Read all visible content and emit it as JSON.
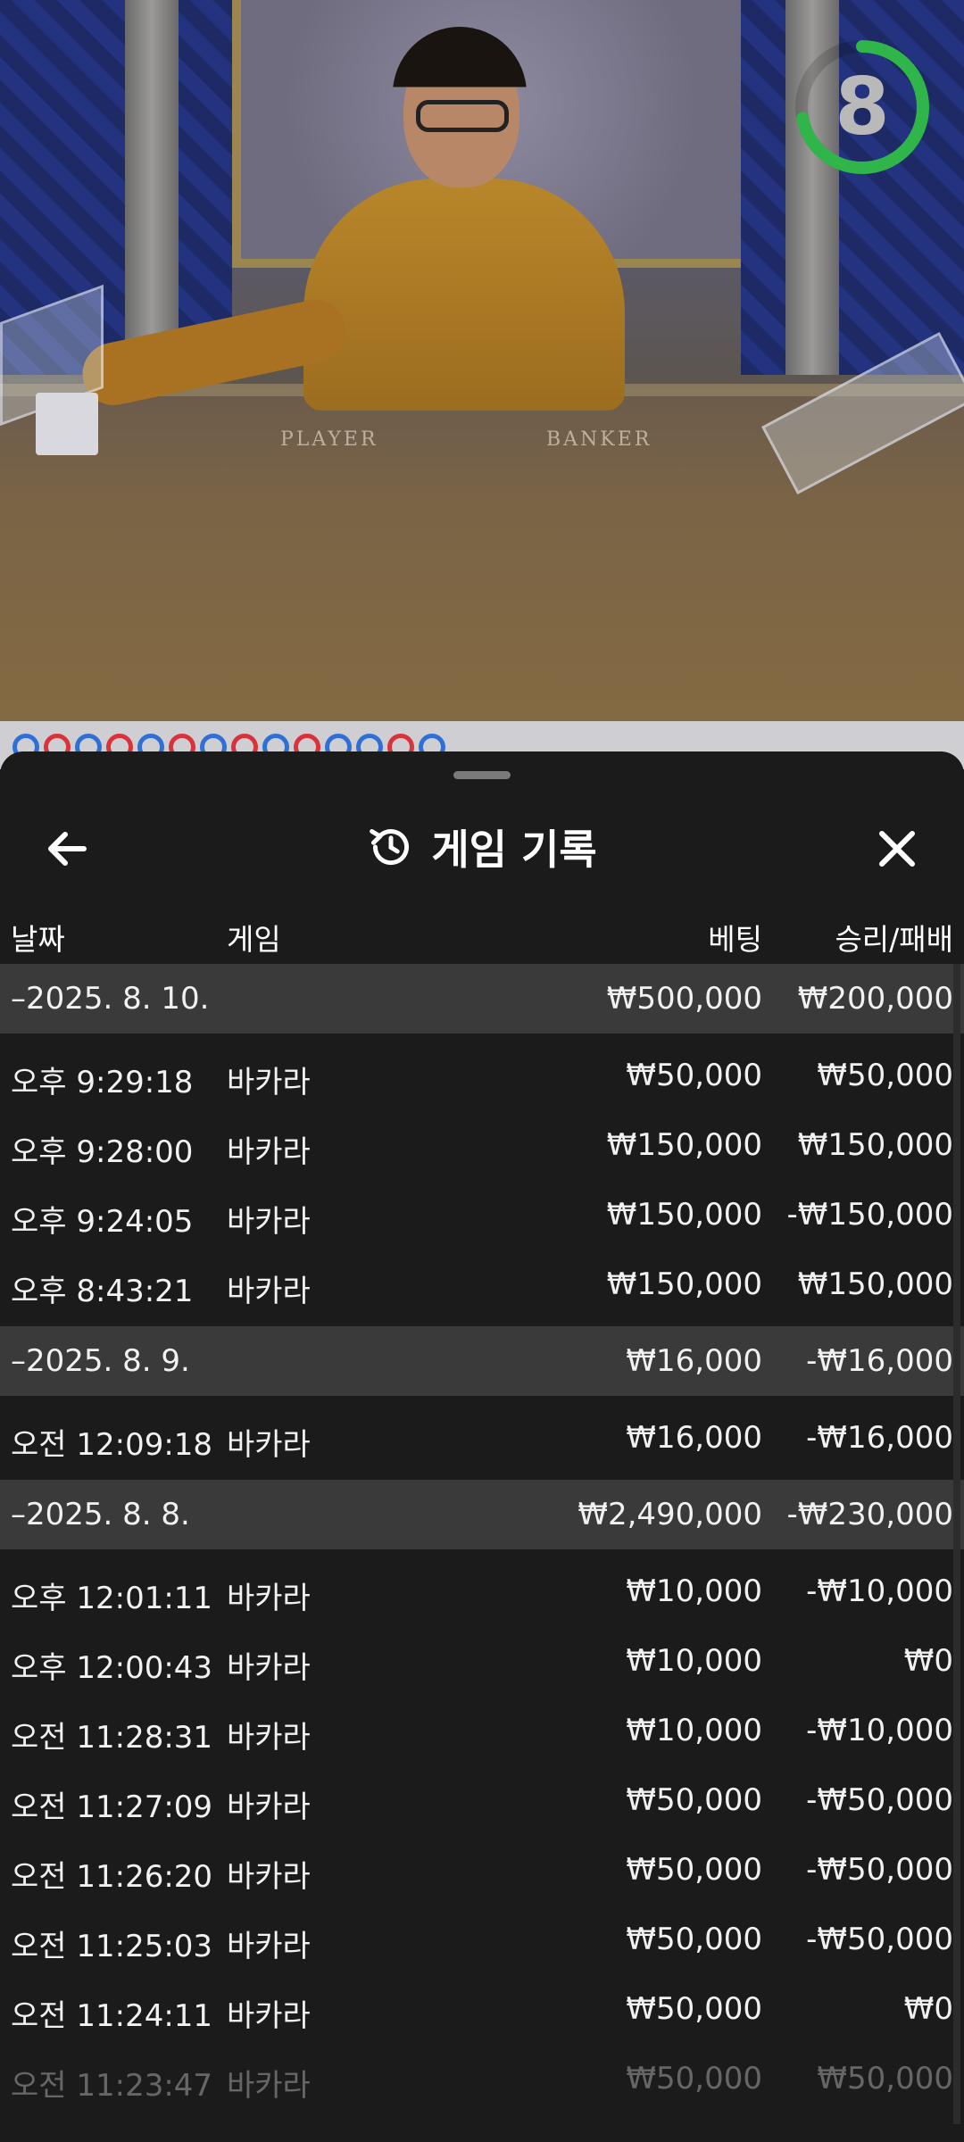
{
  "timer": {
    "value": "8",
    "fraction_remaining": 0.72,
    "color": "#2fb54a"
  },
  "table_felt": {
    "player": "PLAYER",
    "banker": "BANKER"
  },
  "roadmap": {
    "results": [
      "blue",
      "red",
      "blue",
      "red",
      "blue",
      "red",
      "blue",
      "red",
      "blue",
      "red",
      "blue",
      "blue",
      "red",
      "blue"
    ]
  },
  "sheet": {
    "title": "게임 기록",
    "back_icon": "arrow-left-icon",
    "history_icon": "history-icon",
    "close_icon": "close-icon"
  },
  "columns": {
    "date": "날짜",
    "game": "게임",
    "bet": "베팅",
    "win_loss": "승리/패배"
  },
  "rows": [
    {
      "type": "group",
      "date": "–2025. 8. 10.",
      "game": "",
      "bet": "₩500,000",
      "win_loss": "₩200,000"
    },
    {
      "type": "item",
      "date": "오후 9:29:18",
      "game": "바카라",
      "bet": "₩50,000",
      "win_loss": "₩50,000"
    },
    {
      "type": "item",
      "date": "오후 9:28:00",
      "game": "바카라",
      "bet": "₩150,000",
      "win_loss": "₩150,000"
    },
    {
      "type": "item",
      "date": "오후 9:24:05",
      "game": "바카라",
      "bet": "₩150,000",
      "win_loss": "-₩150,000"
    },
    {
      "type": "item",
      "date": "오후 8:43:21",
      "game": "바카라",
      "bet": "₩150,000",
      "win_loss": "₩150,000"
    },
    {
      "type": "group",
      "date": "–2025. 8. 9.",
      "game": "",
      "bet": "₩16,000",
      "win_loss": "-₩16,000"
    },
    {
      "type": "item",
      "date": "오전 12:09:18",
      "game": "바카라",
      "bet": "₩16,000",
      "win_loss": "-₩16,000"
    },
    {
      "type": "group",
      "date": "–2025. 8. 8.",
      "game": "",
      "bet": "₩2,490,000",
      "win_loss": "-₩230,000"
    },
    {
      "type": "item",
      "date": "오후 12:01:11",
      "game": "바카라",
      "bet": "₩10,000",
      "win_loss": "-₩10,000"
    },
    {
      "type": "item",
      "date": "오후 12:00:43",
      "game": "바카라",
      "bet": "₩10,000",
      "win_loss": "₩0"
    },
    {
      "type": "item",
      "date": "오전 11:28:31",
      "game": "바카라",
      "bet": "₩10,000",
      "win_loss": "-₩10,000"
    },
    {
      "type": "item",
      "date": "오전 11:27:09",
      "game": "바카라",
      "bet": "₩50,000",
      "win_loss": "-₩50,000"
    },
    {
      "type": "item",
      "date": "오전 11:26:20",
      "game": "바카라",
      "bet": "₩50,000",
      "win_loss": "-₩50,000"
    },
    {
      "type": "item",
      "date": "오전 11:25:03",
      "game": "바카라",
      "bet": "₩50,000",
      "win_loss": "-₩50,000"
    },
    {
      "type": "item",
      "date": "오전 11:24:11",
      "game": "바카라",
      "bet": "₩50,000",
      "win_loss": "₩0"
    },
    {
      "type": "item",
      "date": "오전 11:23:47",
      "game": "바카라",
      "bet": "₩50,000",
      "win_loss": "₩50,000"
    }
  ]
}
